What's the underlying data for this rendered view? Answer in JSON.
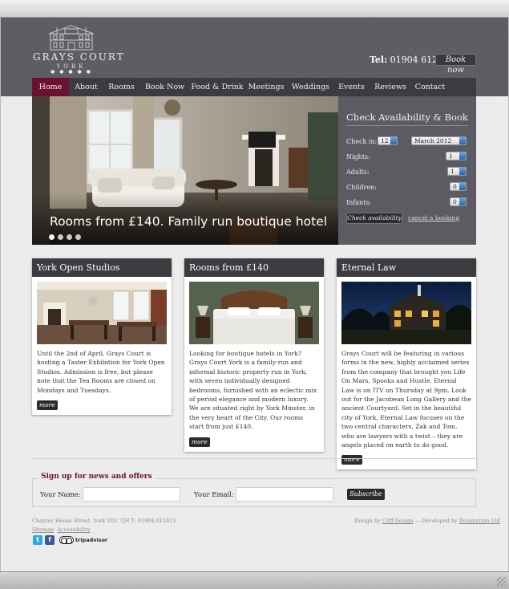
{
  "header": {
    "logo": {
      "name": "GRAYS COURT",
      "city": "YORK",
      "dots": "● ● ● ● ●"
    },
    "tel_label": "Tel:",
    "tel_number": "01904 612613",
    "book_now": "Book now"
  },
  "nav": {
    "items": [
      {
        "label": "Home",
        "active": true
      },
      {
        "label": "About"
      },
      {
        "label": "Rooms"
      },
      {
        "label": "Book Now"
      },
      {
        "label": "Food & Drink"
      },
      {
        "label": "Meetings"
      },
      {
        "label": "Weddings"
      },
      {
        "label": "Events"
      },
      {
        "label": "Reviews"
      },
      {
        "label": "Contact"
      }
    ]
  },
  "hero": {
    "caption": "Rooms from £140. Family run boutique hotel",
    "slides": 4,
    "active_slide": 1
  },
  "booking": {
    "title": "Check Availability & Book",
    "checkin_label": "Check in:",
    "checkin_day": "12",
    "checkin_month": "March 2012",
    "nights_label": "Nights:",
    "nights_value": "1",
    "adults_label": "Adults:",
    "adults_value": "1",
    "children_label": "Children:",
    "children_value": "0",
    "infants_label": "Infants:",
    "infants_value": "0",
    "check_button": "Check availability",
    "cancel_link": "cancel a booking"
  },
  "cards": [
    {
      "title": "York Open Studios",
      "image": "dining-room-photo",
      "text": "Until the 2nd of April, Grays Court is hosting a Taster Exhibition for York Open Studios. Admission is free, but please note that the Tea Rooms are closed on Mondays and Tuesdays.",
      "more": "more"
    },
    {
      "title": "Rooms from £140",
      "image": "bedroom-photo",
      "text": "Looking for boutique hotels in York? Grays Court York is a family-run and informal historic property run in York, with seven individually designed bedrooms, furnished with an eclectic mix of period elegance and modern luxury. We are situated right by York Minster, in the very heart of the City. Our rooms start from just £140.",
      "more": "more"
    },
    {
      "title": "Eternal Law",
      "image": "night-house-photo",
      "text": "Grays Court will be featuring in various forms in the new, highly acclaimed series from the company that brought you Life On Mars, Spooks and Hustle. Eternal Law is on ITV on Thursday at 9pm. Look out for the Jacobean Long Gallery and the ancient Courtyard. Set in the beautiful city of York, Eternal Law focuses on the two central characters, Zak and Tom, who are lawyers with a twist – they are angels placed on earth to do good.",
      "more": "more"
    }
  ],
  "signup": {
    "legend": "Sign up for news and offers",
    "name_label": "Your Name:",
    "email_label": "Your Email:",
    "subscribe": "Subscribe"
  },
  "footer": {
    "address": "Chapter House Street, York YO1 7JH T: 01904 612613",
    "sitemap": "Sitemap",
    "accessibility": "Accessibility",
    "design_prefix": "Design by",
    "design_by": "Cliff Design",
    "dev_prefix": "— Developed by",
    "developed_by": "Designition Ltd",
    "tripadvisor": "tripadvisor",
    "social_icons": [
      "twitter-icon",
      "facebook-icon",
      "tripadvisor-icon"
    ]
  },
  "colors": {
    "accent": "#6c0f30",
    "header_bg": "#5d5d63",
    "nav_bg": "#3b3b40",
    "page_bg": "#ececec"
  }
}
